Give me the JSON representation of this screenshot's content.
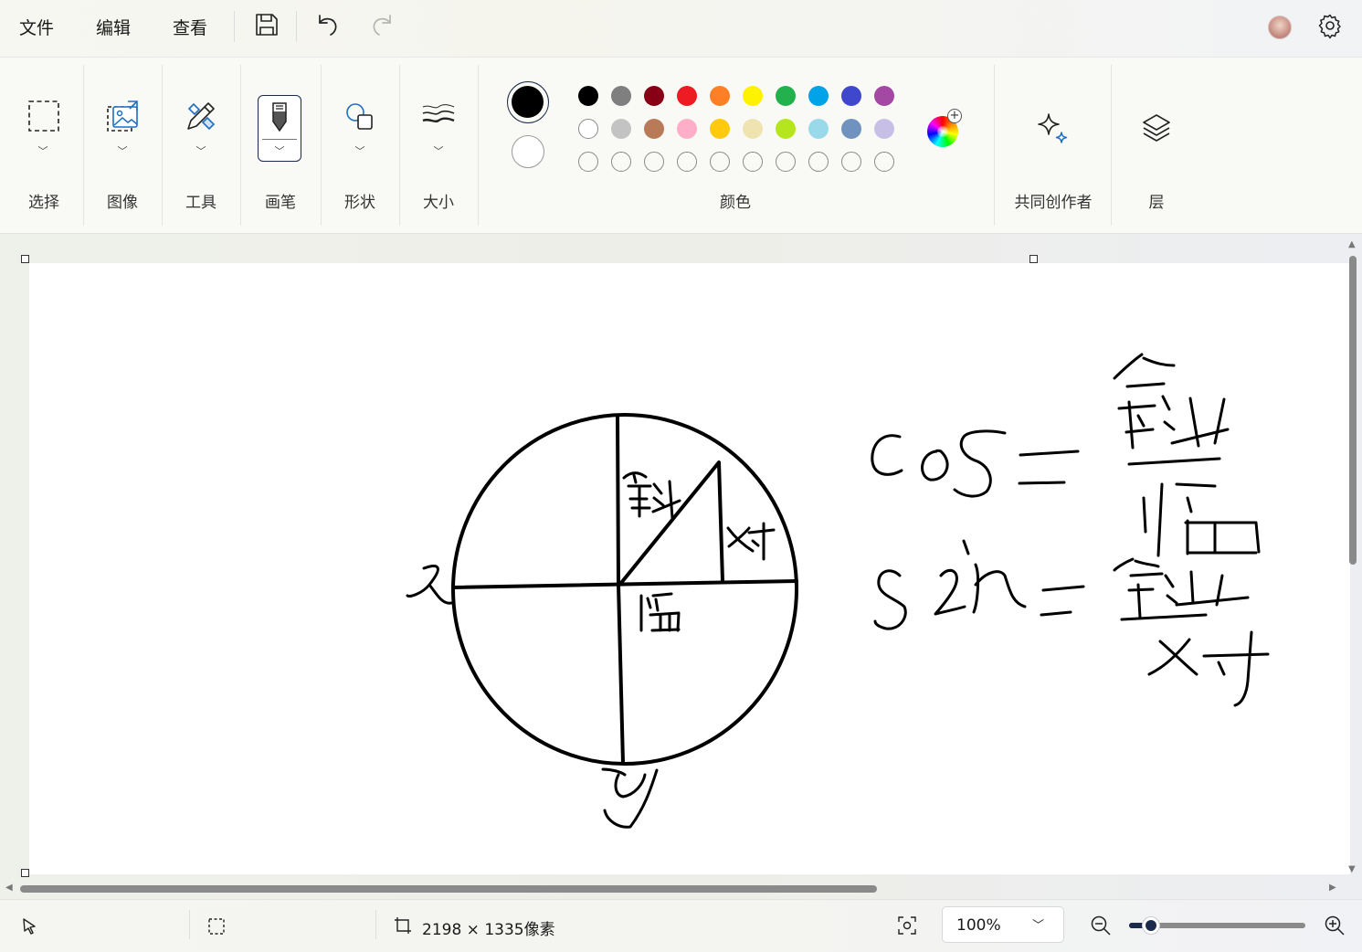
{
  "menu": {
    "file": "文件",
    "edit": "编辑",
    "view": "查看"
  },
  "ribbon": {
    "select_label": "选择",
    "image_label": "图像",
    "tools_label": "工具",
    "brush_label": "画笔",
    "shapes_label": "形状",
    "size_label": "大小",
    "colors_label": "颜色",
    "cocreator_label": "共同创作者",
    "layers_label": "层"
  },
  "colors": {
    "primary": "#000000",
    "secondary": "#ffffff",
    "palette_row1": [
      "#000000",
      "#7f7f7f",
      "#880015",
      "#ed1c24",
      "#ff7f27",
      "#fff200",
      "#22b14c",
      "#00a2e8",
      "#3f48cc",
      "#a349a4"
    ],
    "palette_row2": [
      "#ffffff",
      "#c3c3c3",
      "#b97a57",
      "#ffaec9",
      "#ffc90e",
      "#efe4b0",
      "#b5e61d",
      "#99d9ea",
      "#7092be",
      "#c8bfe7"
    ],
    "palette_row3_count": 10
  },
  "status": {
    "canvas_size": "2198 × 1335像素",
    "zoom": "100%",
    "zoom_slider_value": 0.08
  }
}
